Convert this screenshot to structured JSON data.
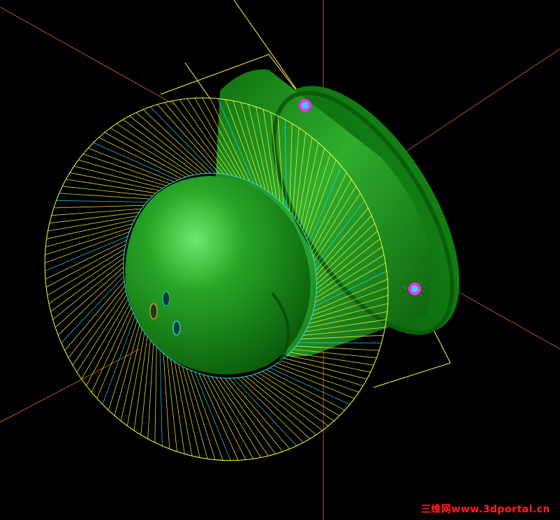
{
  "colors": {
    "background": "#000000",
    "axis": "#b5561c",
    "wire": "#ffff3c",
    "wire_inner": "#22e0ff",
    "solid_dark": "#0a5a0a",
    "solid_mid": "#1f9a1f",
    "solid_light": "#6dea6d",
    "marker_ring": "#ff2bff",
    "marker_core": "#22e0ff",
    "watermark": "#ff1e1e"
  },
  "watermark": "三维网www.3dportal.cn"
}
